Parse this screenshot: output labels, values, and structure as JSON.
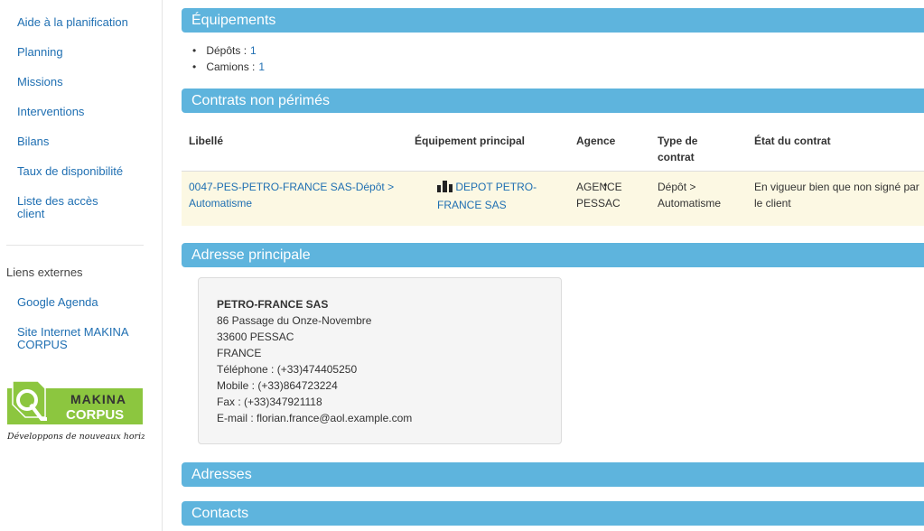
{
  "sidebar": {
    "items": [
      {
        "label": "Aide à la planification"
      },
      {
        "label": "Planning"
      },
      {
        "label": "Missions"
      },
      {
        "label": "Interventions"
      },
      {
        "label": "Bilans"
      },
      {
        "label": "Taux de disponibilité"
      },
      {
        "label": "Liste des accès client"
      }
    ],
    "external_header": "Liens externes",
    "external_links": [
      {
        "label": "Google Agenda"
      },
      {
        "label": "Site Internet MAKINA CORPUS"
      }
    ],
    "logo": {
      "word1": "MAKINA",
      "word2": "CORPUS",
      "tagline": "Développons de nouveaux horizons",
      "color": "#8cc63f"
    }
  },
  "sections": {
    "equipements": {
      "title": "Équipements",
      "items": [
        {
          "label": "Dépôts :",
          "value": "1"
        },
        {
          "label": "Camions :",
          "value": "1"
        }
      ]
    },
    "contrats": {
      "title": "Contrats non périmés",
      "columns": [
        "Libellé",
        "Équipement principal",
        "Agence",
        "Type de contrat",
        "État du contrat"
      ],
      "rows": [
        {
          "libelle": "0047-PES-PETRO-FRANCE SAS-Dépôt > Automatisme",
          "equipement": "DEPOT PETRO-FRANCE SAS",
          "equipement_icon": "bar-chart-icon",
          "agence": "AGENCE PESSAC",
          "type": "Dépôt > Automatisme",
          "etat": "En vigueur bien que non signé par le client"
        }
      ]
    },
    "adresse_principale": {
      "title": "Adresse principale",
      "name": "PETRO-FRANCE SAS",
      "street": "86 Passage du Onze-Novembre",
      "city": "33600 PESSAC",
      "country": "FRANCE",
      "telephone": "Téléphone : (+33)474405250",
      "mobile": "Mobile : (+33)864723224",
      "fax": "Fax : (+33)347921118",
      "email": "E-mail : florian.france@aol.example.com"
    },
    "adresses": {
      "title": "Adresses"
    },
    "contacts": {
      "title": "Contacts"
    }
  },
  "colors": {
    "header_bg": "#5eb4dd",
    "link": "#1f6fb2",
    "row_highlight": "#fcf8e3"
  }
}
